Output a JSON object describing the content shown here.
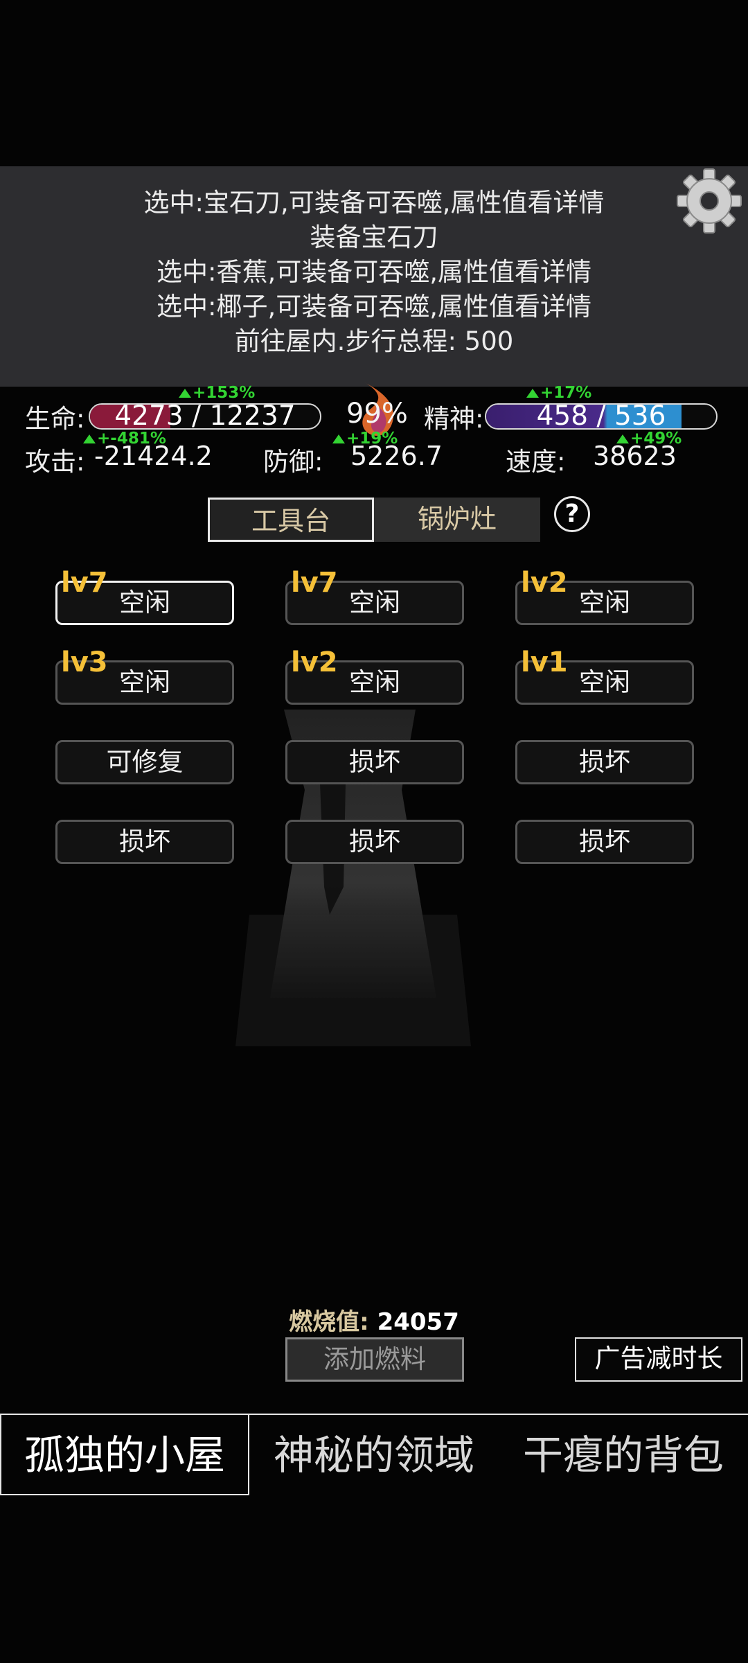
{
  "log": {
    "lines": [
      "选中:宝石刀,可装备可吞噬,属性值看详情",
      "装备宝石刀",
      "选中:香蕉,可装备可吞噬,属性值看详情",
      "选中:椰子,可装备可吞噬,属性值看详情",
      "前往屋内.步行总程: 500"
    ]
  },
  "stats": {
    "hp_label": "生命:",
    "hp_value": "4273 / 12237",
    "hp_fraction": 0.35,
    "hp_delta": "+153%",
    "fire_percent": "99%",
    "spirit_label": "精神:",
    "spirit_value": "458 / 536",
    "spirit_fraction": 0.85,
    "spirit_delta": "+17%",
    "attack_label": "攻击:",
    "attack_value": "-21424.2",
    "attack_delta": "+-481%",
    "defense_label": "防御:",
    "defense_value": "5226.7",
    "defense_delta": "+19%",
    "speed_label": "速度:",
    "speed_value": "38623",
    "speed_delta": "+49%"
  },
  "tabs": {
    "workbench": "工具台",
    "stove": "锅炉灶",
    "help": "?"
  },
  "slots": [
    {
      "level": "lv7",
      "status": "空闲"
    },
    {
      "level": "lv7",
      "status": "空闲"
    },
    {
      "level": "lv2",
      "status": "空闲"
    },
    {
      "level": "lv3",
      "status": "空闲"
    },
    {
      "level": "lv2",
      "status": "空闲"
    },
    {
      "level": "lv1",
      "status": "空闲"
    },
    {
      "level": "",
      "status": "可修复"
    },
    {
      "level": "",
      "status": "损坏"
    },
    {
      "level": "",
      "status": "损坏"
    },
    {
      "level": "",
      "status": "损坏"
    },
    {
      "level": "",
      "status": "损坏"
    },
    {
      "level": "",
      "status": "损坏"
    }
  ],
  "bottom": {
    "burn_label": "燃烧值:",
    "burn_value": "24057",
    "add_fuel": "添加燃料",
    "ad_button": "广告减时长"
  },
  "main_tabs": {
    "hut": "孤独的小屋",
    "domain": "神秘的领域",
    "bag": "干瘪的背包"
  },
  "colors": {
    "hp_bar": "#8a1a3a",
    "spirit_bar_left": "#4a2a8a",
    "spirit_bar_right": "#2d8fd0",
    "level_text": "#f5c038",
    "delta_text": "#33d433"
  }
}
